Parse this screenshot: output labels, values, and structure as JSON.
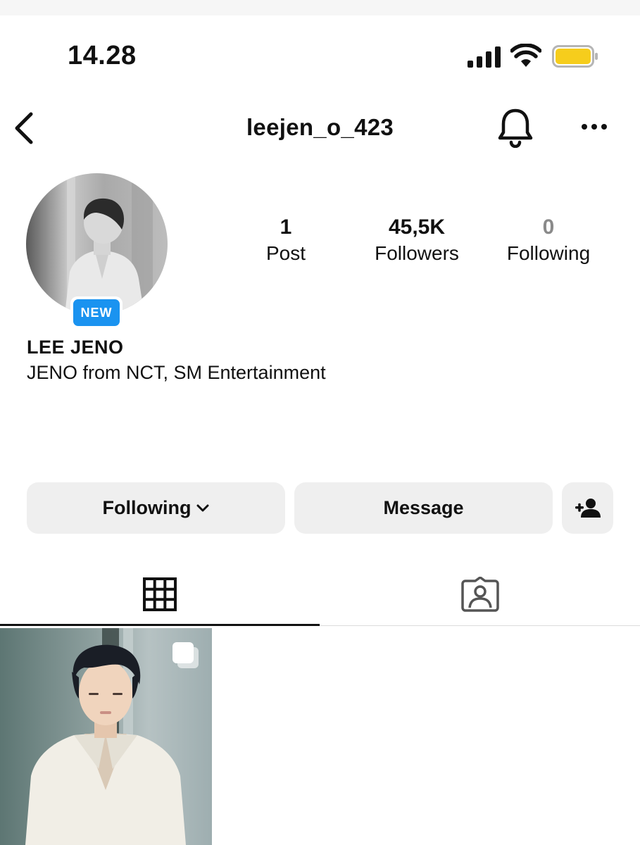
{
  "status_bar": {
    "time": "14.28",
    "battery_color": "#f6cd1c"
  },
  "header": {
    "username": "leejen_o_423",
    "back_icon": "chevron-left-icon",
    "bell_icon": "bell-icon",
    "more_icon": "more-horizontal-icon"
  },
  "profile": {
    "new_badge": "NEW",
    "display_name": "LEE JENO",
    "bio": "JENO from NCT, SM Entertainment",
    "stats": [
      {
        "value": "1",
        "label": "Post"
      },
      {
        "value": "45,5K",
        "label": "Followers"
      },
      {
        "value": "0",
        "label": "Following"
      }
    ]
  },
  "actions": {
    "following_label": "Following",
    "message_label": "Message",
    "add_icon": "add-person-icon"
  },
  "tabs": [
    {
      "icon": "grid-icon",
      "active": true
    },
    {
      "icon": "tagged-person-icon",
      "active": false
    }
  ],
  "colors": {
    "accent_blue": "#1a93f0",
    "button_bg": "#efefef",
    "muted_text": "#8a8a8a"
  }
}
